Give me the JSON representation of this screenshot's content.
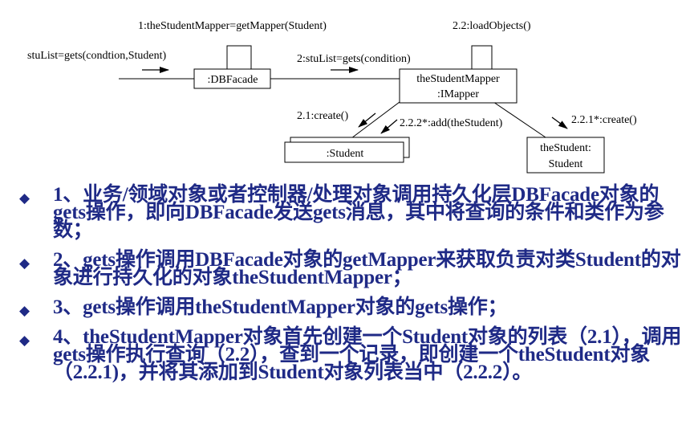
{
  "diagram": {
    "nodes": {
      "dbfacade": ":DBFacade",
      "mapper_line1": "theStudentMapper",
      "mapper_line2": ":IMapper",
      "student_collection": ":Student",
      "the_student_line1": "theStudent:",
      "the_student_line2": "Student"
    },
    "messages": {
      "gets": "stuList=gets(condtion,Student)",
      "get_mapper": "1:theStudentMapper=getMapper(Student)",
      "mapper_gets": "2:stuList=gets(condition)",
      "load_objects": "2.2:loadObjects()",
      "create_list": "2.1:create()",
      "add_student": "2.2.2*:add(theStudent)",
      "create_student": "2.2.1*:create()"
    }
  },
  "bullets": [
    "1、业务/领域对象或者控制器/处理对象调用持久化层DBFacade对象的gets操作，即向DBFacade发送gets消息，其中将查询的条件和类作为参数；",
    "2、gets操作调用DBFacade对象的getMapper来获取负责对类Student的对象进行持久化的对象theStudentMapper；",
    "3、gets操作调用theStudentMapper对象的gets操作；",
    "4、theStudentMapper对象首先创建一个Student对象的列表（2.1），调用gets操作执行查询（2.2），查到一个记录，即创建一个theStudent对象（2.2.1)，并将其添加到Student对象列表当中（2.2.2）。"
  ],
  "colors": {
    "text": "#1f2a86",
    "diagram": "#000000"
  }
}
